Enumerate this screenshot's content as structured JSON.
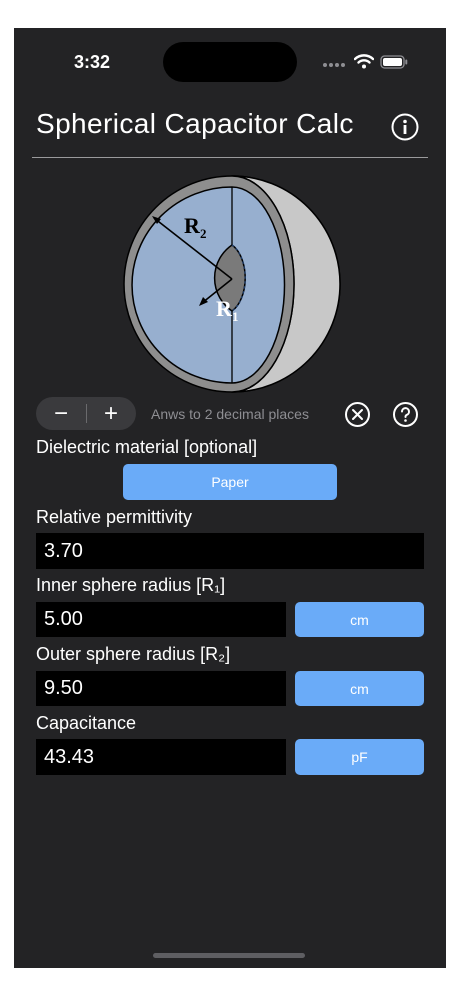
{
  "status": {
    "time": "3:32"
  },
  "header": {
    "title": "Spherical Capacitor Calc"
  },
  "diagram": {
    "outer_label": "R",
    "outer_sub": "2",
    "inner_label": "R",
    "inner_sub": "1"
  },
  "controls": {
    "minus": "−",
    "plus": "+",
    "decimals": "Anws to 2 decimal places"
  },
  "dielectric": {
    "label": "Dielectric material [optional]",
    "value": "Paper"
  },
  "permittivity": {
    "label": "Relative permittivity",
    "value": "3.70"
  },
  "inner_radius": {
    "label": "Inner sphere radius [R₁]",
    "value": "5.00",
    "unit": "cm"
  },
  "outer_radius": {
    "label": "Outer sphere radius [R₂]",
    "value": "9.50",
    "unit": "cm"
  },
  "capacitance": {
    "label": "Capacitance",
    "value": "43.43",
    "unit": "pF"
  },
  "colors": {
    "background": "#232325",
    "accent": "#6aabf8",
    "field": "#000000"
  }
}
